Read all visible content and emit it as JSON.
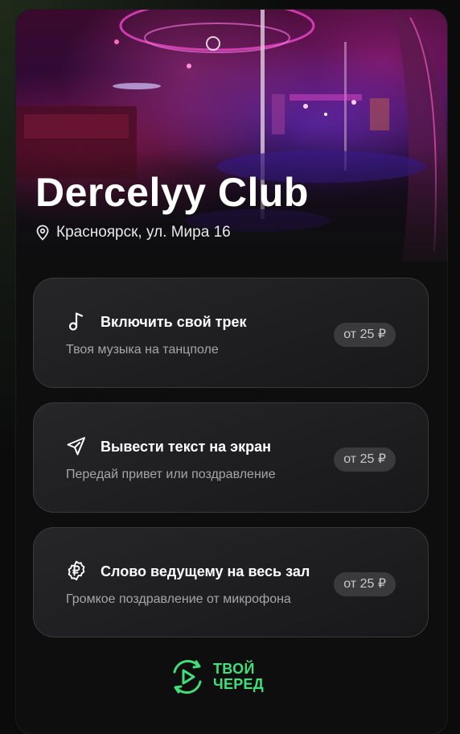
{
  "club": {
    "name": "Dercelyy Club",
    "address": "Красноярск, ул. Мира 16"
  },
  "services": [
    {
      "icon": "music-note-icon",
      "title": "Включить свой трек",
      "subtitle": "Твоя музыка на танцполе",
      "price": "от 25 ₽"
    },
    {
      "icon": "send-icon",
      "title": "Вывести текст на экран",
      "subtitle": "Передай привет или поздравление",
      "price": "от 25 ₽"
    },
    {
      "icon": "ruble-badge-icon",
      "title": "Слово ведущему на весь зал",
      "subtitle": "Громкое поздравление от микрофона",
      "price": "от 25 ₽"
    }
  ],
  "brand": {
    "line1": "ТВОЙ",
    "line2": "ЧЕРЕД",
    "color": "#3fe07a"
  }
}
